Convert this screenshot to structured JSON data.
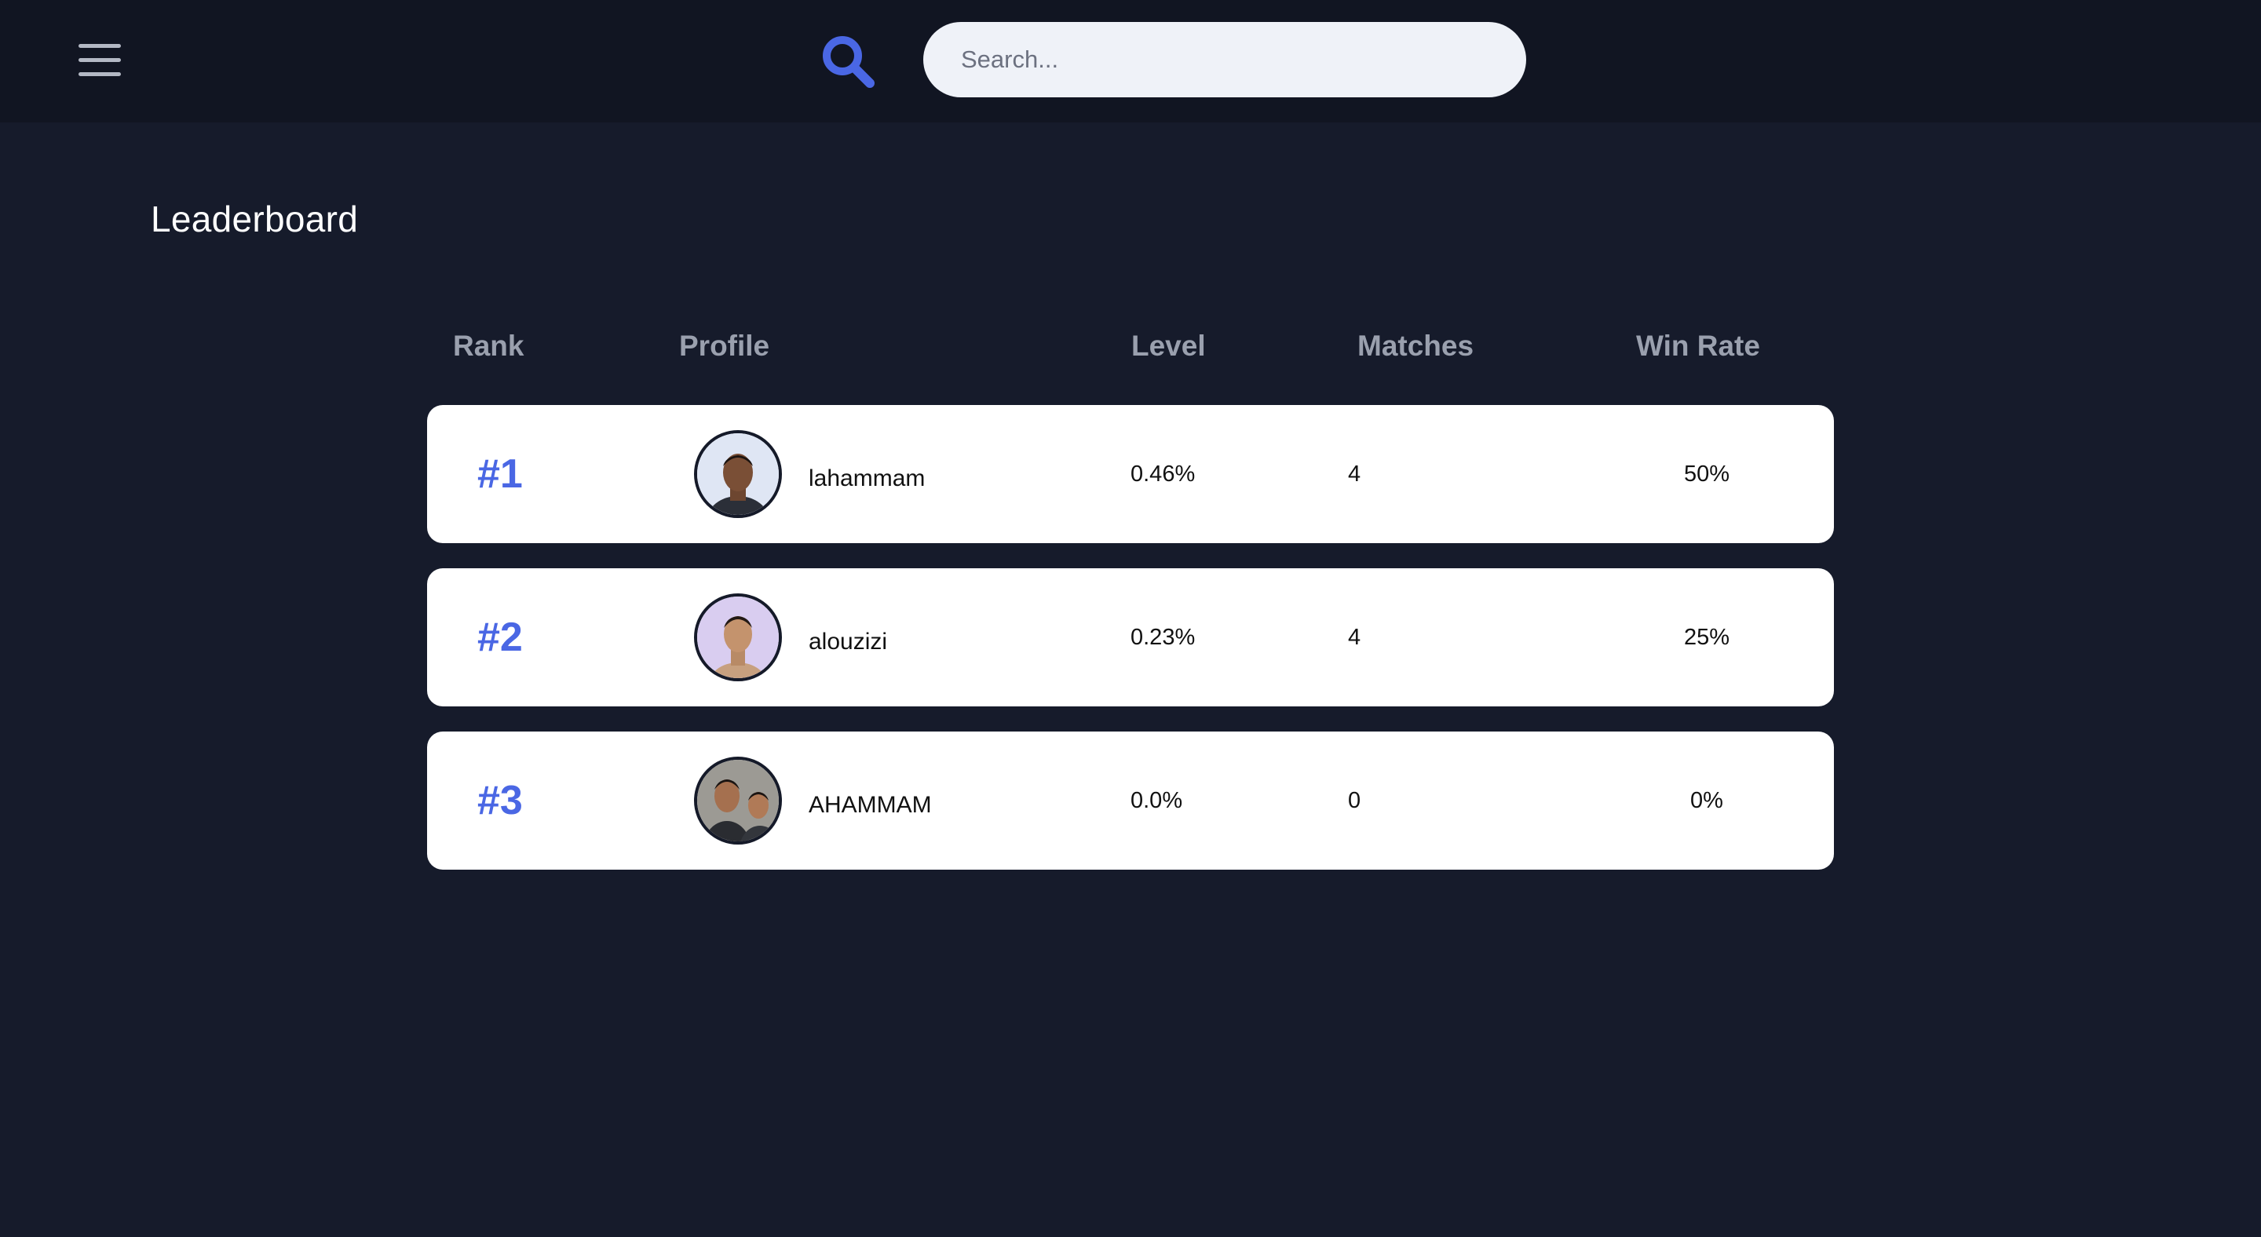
{
  "header": {
    "search_placeholder": "Search..."
  },
  "page": {
    "title": "Leaderboard"
  },
  "table": {
    "columns": [
      "Rank",
      "Profile",
      "Level",
      "Matches",
      "Win Rate"
    ],
    "rows": [
      {
        "rank": "#1",
        "username": "lahammam",
        "level": "0.46%",
        "matches": "4",
        "win_rate": "50%"
      },
      {
        "rank": "#2",
        "username": "alouzizi",
        "level": "0.23%",
        "matches": "4",
        "win_rate": "25%"
      },
      {
        "rank": "#3",
        "username": "AHAMMAM",
        "level": "0.0%",
        "matches": "0",
        "win_rate": "0%"
      }
    ]
  },
  "colors": {
    "accent": "#4a67e4",
    "background": "#161b2b",
    "topbar": "#111522",
    "card": "#ffffff",
    "header_text": "#9aa0ae"
  },
  "icons": {
    "menu": "hamburger-menu-icon",
    "search": "magnifier-icon"
  }
}
